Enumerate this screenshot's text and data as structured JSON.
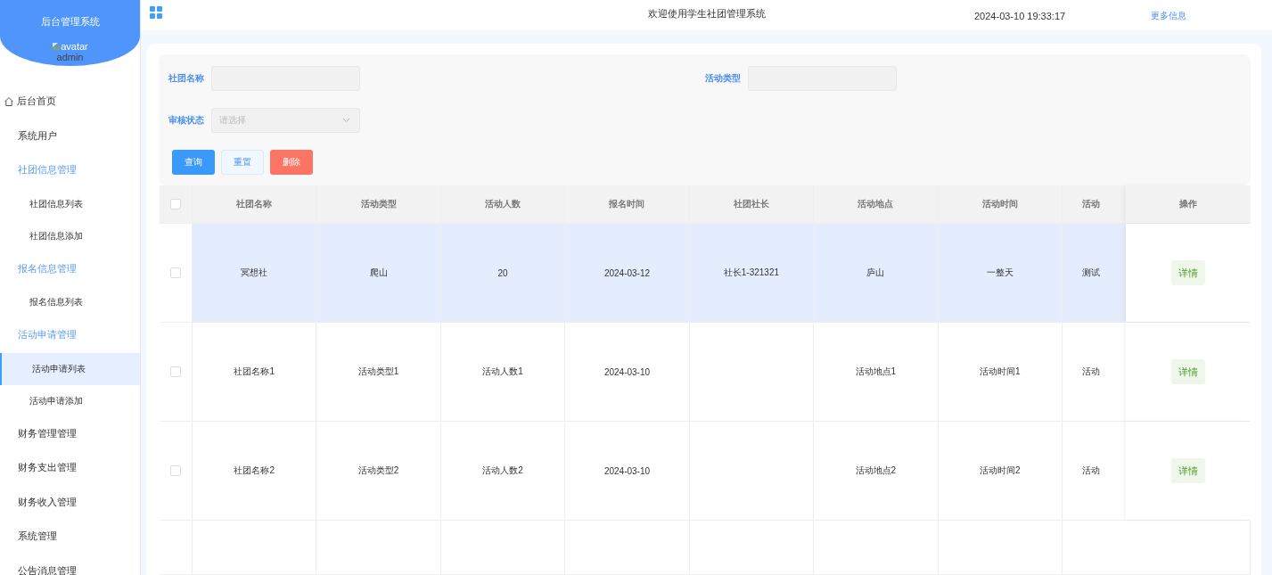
{
  "header": {
    "title": "欢迎使用学生社团管理系统",
    "datetime": "2024-03-10 19:33:17",
    "more_link": "更多信息"
  },
  "sidebar": {
    "title": "后台管理系统",
    "avatar_alt": "avatar",
    "username": "admin",
    "items": [
      {
        "label": "后台首页",
        "kind": "home",
        "selected": false
      },
      {
        "label": "系统用户",
        "kind": "item",
        "selected": false
      },
      {
        "label": "社团信息管理",
        "kind": "group",
        "selected": false,
        "expanded": true,
        "children": [
          {
            "label": "社团信息列表",
            "selected": false
          },
          {
            "label": "社团信息添加",
            "selected": false
          }
        ]
      },
      {
        "label": "报名信息管理",
        "kind": "group",
        "selected": false,
        "expanded": true,
        "children": [
          {
            "label": "报名信息列表",
            "selected": false
          }
        ]
      },
      {
        "label": "活动申请管理",
        "kind": "group",
        "selected": false,
        "expanded": true,
        "children": [
          {
            "label": "活动申请列表",
            "selected": true
          },
          {
            "label": "活动申请添加",
            "selected": false
          }
        ]
      },
      {
        "label": "财务管理管理",
        "kind": "item",
        "selected": false
      },
      {
        "label": "财务支出管理",
        "kind": "item",
        "selected": false
      },
      {
        "label": "财务收入管理",
        "kind": "item",
        "selected": false
      },
      {
        "label": "系统管理",
        "kind": "item",
        "selected": false
      },
      {
        "label": "公告消息管理",
        "kind": "item",
        "selected": false
      }
    ]
  },
  "filters": [
    {
      "label": "社团名称",
      "kind": "input"
    },
    {
      "label": "活动类型",
      "kind": "input"
    },
    {
      "label": "审核状态",
      "kind": "select",
      "placeholder": "请选择"
    }
  ],
  "buttons": [
    {
      "label": "查询",
      "kind": "primary"
    },
    {
      "label": "重置",
      "kind": "plain"
    },
    {
      "label": "删除",
      "kind": "danger"
    }
  ],
  "table": {
    "header_checked": false,
    "columns": [
      "社团名称",
      "活动类型",
      "活动人数",
      "报名时间",
      "社团社长",
      "活动地点",
      "活动时间",
      "活动"
    ],
    "action_column": "操作",
    "rows": [
      {
        "selected": true,
        "checked": false,
        "cells": [
          "冥想社",
          "爬山",
          "20",
          "2024-03-12",
          "社长1-321321",
          "庐山",
          "一整天",
          "测试"
        ],
        "action": "详情"
      },
      {
        "selected": false,
        "checked": false,
        "cells": [
          "社团名称1",
          "活动类型1",
          "活动人数1",
          "2024-03-10",
          "",
          "活动地点1",
          "活动时间1",
          "活动"
        ],
        "action": "详情"
      },
      {
        "selected": false,
        "checked": false,
        "cells": [
          "社团名称2",
          "活动类型2",
          "活动人数2",
          "2024-03-10",
          "",
          "活动地点2",
          "活动时间2",
          "活动"
        ],
        "action": "详情"
      }
    ]
  }
}
